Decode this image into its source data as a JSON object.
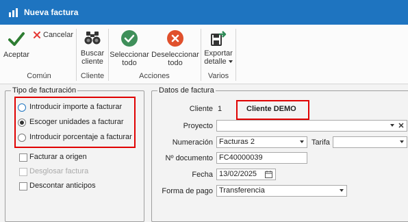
{
  "window": {
    "title": "Nueva factura"
  },
  "ribbon": {
    "accept_label": "Aceptar",
    "cancel_label": "Cancelar",
    "search_client_label": [
      "Buscar",
      "cliente"
    ],
    "select_all_label": [
      "Seleccionar",
      "todo"
    ],
    "deselect_all_label": [
      "Deseleccionar",
      "todo"
    ],
    "export_label": [
      "Exportar",
      "detalle"
    ],
    "groups": {
      "common": "Común",
      "client": "Cliente",
      "actions": "Acciones",
      "misc": "Varios"
    }
  },
  "billing_type": {
    "title": "Tipo de facturación",
    "options": [
      "Introducir importe a facturar",
      "Escoger unidades a facturar",
      "Introducir porcentaje a facturar"
    ],
    "checkboxes": [
      "Facturar a origen",
      "Desglosar factura",
      "Descontar anticipos"
    ]
  },
  "invoice": {
    "title": "Datos de factura",
    "client_label": "Cliente",
    "client_id": "1",
    "client_name": "Cliente DEMO",
    "project_label": "Proyecto",
    "project_value": "",
    "numbering_label": "Numeración",
    "numbering_value": "Facturas 2",
    "rate_label": "Tarifa",
    "rate_value": "",
    "doc_number_label": "Nº documento",
    "doc_number_value": "FC40000039",
    "date_label": "Fecha",
    "date_value": "13/02/2025",
    "payment_label": "Forma de pago",
    "payment_value": "Transferencia"
  },
  "colors": {
    "titlebar": "#1e74c0",
    "accept_green": "#2e7d32",
    "cancel_red": "#e53935",
    "select_green": "#3f8f5a",
    "deselect_red": "#e0502c",
    "highlight": "#e00000"
  }
}
